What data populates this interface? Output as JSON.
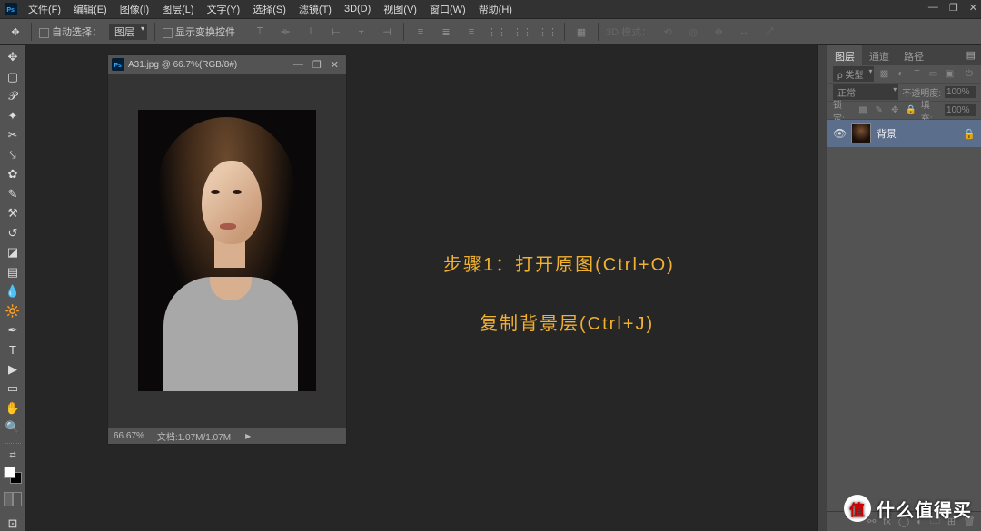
{
  "menubar": {
    "items": [
      "文件(F)",
      "编辑(E)",
      "图像(I)",
      "图层(L)",
      "文字(Y)",
      "选择(S)",
      "滤镜(T)",
      "3D(D)",
      "视图(V)",
      "窗口(W)",
      "帮助(H)"
    ]
  },
  "optionsbar": {
    "auto_select": "自动选择：",
    "layer_sel": "图层",
    "show_transform": "显示变换控件",
    "mode_3d": "3D 模式："
  },
  "tools": {
    "names": [
      "move-tool",
      "marquee-tool",
      "lasso-tool",
      "quick-select-tool",
      "crop-tool",
      "eyedropper-tool",
      "healing-brush-tool",
      "brush-tool",
      "clone-stamp-tool",
      "history-brush-tool",
      "eraser-tool",
      "gradient-tool",
      "blur-tool",
      "dodge-tool",
      "pen-tool",
      "type-tool",
      "path-select-tool",
      "rectangle-tool",
      "hand-tool",
      "zoom-tool"
    ]
  },
  "doc": {
    "title": "A31.jpg @ 66.7%(RGB/8#)",
    "zoom": "66.67%",
    "docinfo": "文档:1.07M/1.07M"
  },
  "annotation": {
    "line1": "步骤1：打开原图(Ctrl+O)",
    "line2": "复制背景层(Ctrl+J)"
  },
  "panels": {
    "tabs": {
      "layers": "图层",
      "channels": "通道",
      "paths": "路径"
    },
    "kind": "ρ 类型",
    "blend": "正常",
    "opacity_label": "不透明度:",
    "opacity": "100%",
    "lock_label": "锁定:",
    "fill_label": "填充:",
    "fill": "100%",
    "layer0": {
      "name": "背景"
    }
  },
  "watermark": {
    "badge": "值",
    "text": "什么值得买"
  }
}
